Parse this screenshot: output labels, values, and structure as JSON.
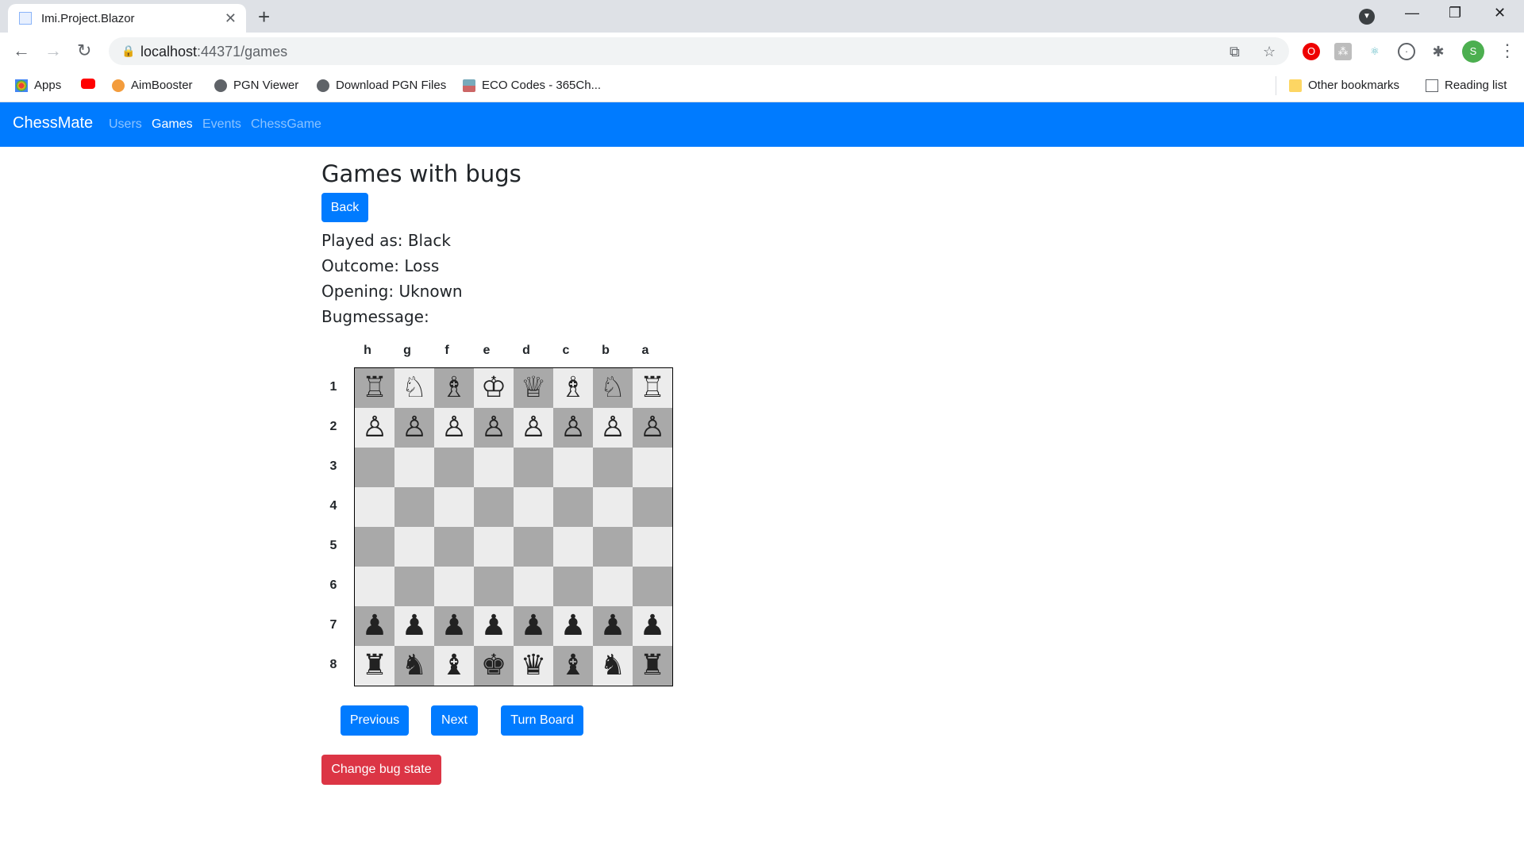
{
  "browser": {
    "tab_title": "Imi.Project.Blazor",
    "tab_close": "✕",
    "new_tab": "+",
    "url_host": "localhost",
    "url_rest": ":44371/games",
    "win_min": "—",
    "win_max": "❐",
    "win_close": "✕",
    "profile_initial": "S",
    "bookmarks": [
      {
        "label": "Apps",
        "icon": "apps-grid-icon"
      },
      {
        "label": "",
        "icon": "youtube-icon"
      },
      {
        "label": "AimBooster",
        "icon": "aimbooster-icon"
      },
      {
        "label": "PGN Viewer",
        "icon": "globe-icon"
      },
      {
        "label": "Download PGN Files",
        "icon": "globe-icon"
      },
      {
        "label": "ECO Codes - 365Ch...",
        "icon": "image-icon"
      }
    ],
    "other_bookmarks": "Other bookmarks",
    "reading_list": "Reading list"
  },
  "navbar": {
    "brand": "ChessMate",
    "links": [
      "Users",
      "Games",
      "Events",
      "ChessGame"
    ],
    "active": "Games",
    "color": "#007bff"
  },
  "page": {
    "title": "Games with bugs",
    "back_label": "Back",
    "played_as": "Played as: Black",
    "outcome": "Outcome: Loss",
    "opening": "Opening: Uknown",
    "bugmessage": "Bugmessage:",
    "previous_label": "Previous",
    "next_label": "Next",
    "turn_board_label": "Turn Board",
    "change_bug_label": "Change bug state"
  },
  "board": {
    "files": [
      "h",
      "g",
      "f",
      "e",
      "d",
      "c",
      "b",
      "a"
    ],
    "ranks": [
      "1",
      "2",
      "3",
      "4",
      "5",
      "6",
      "7",
      "8"
    ],
    "pieces": [
      [
        "♖",
        "♘",
        "♗",
        "♔",
        "♕",
        "♗",
        "♘",
        "♖"
      ],
      [
        "♙",
        "♙",
        "♙",
        "♙",
        "♙",
        "♙",
        "♙",
        "♙"
      ],
      [
        "",
        "",
        "",
        "",
        "",
        "",
        "",
        ""
      ],
      [
        "",
        "",
        "",
        "",
        "",
        "",
        "",
        ""
      ],
      [
        "",
        "",
        "",
        "",
        "",
        "",
        "",
        ""
      ],
      [
        "",
        "",
        "",
        "",
        "",
        "",
        "",
        ""
      ],
      [
        "♟",
        "♟",
        "♟",
        "♟",
        "♟",
        "♟",
        "♟",
        "♟"
      ],
      [
        "♜",
        "♞",
        "♝",
        "♚",
        "♛",
        "♝",
        "♞",
        "♜"
      ]
    ],
    "dark_color": "#a9a9a9",
    "light_color": "#ececec"
  }
}
